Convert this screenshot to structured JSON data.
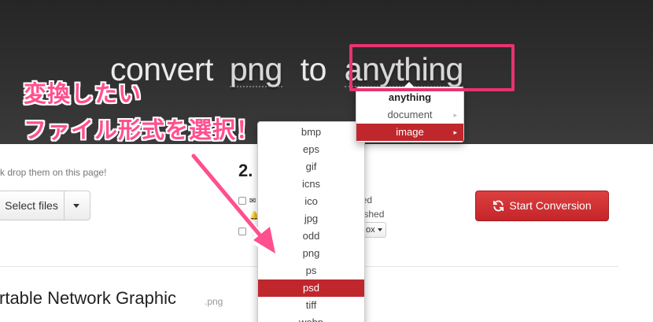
{
  "header": {
    "prefix": "convert",
    "source_format": "png",
    "connector": "to",
    "target_format": "anything"
  },
  "annotation": {
    "line1": "変換したい",
    "line2": "ファイル形式を選択！",
    "color": "#ff4f8e"
  },
  "format_menu": {
    "title": "anything",
    "categories": [
      {
        "label": "document",
        "arrow": "▸"
      },
      {
        "label": "image",
        "arrow": "▸",
        "selected": true
      }
    ]
  },
  "image_submenu": {
    "items": [
      "bmp",
      "eps",
      "gif",
      "icns",
      "ico",
      "jpg",
      "odd",
      "png",
      "ps",
      "psd",
      "tiff",
      "webp"
    ],
    "selected": "psd"
  },
  "step1": {
    "hint": "k drop them on this page!",
    "select_files_label": "Select files"
  },
  "step2": {
    "number": "2.",
    "option_fragments": [
      "hed",
      "nished"
    ],
    "dropdown_fragment": "ox"
  },
  "actions": {
    "start_conversion_label": "Start Conversion",
    "accent_color": "#c4252a"
  },
  "format_info": {
    "title": "rtable Network Graphic",
    "extension": ".png"
  }
}
